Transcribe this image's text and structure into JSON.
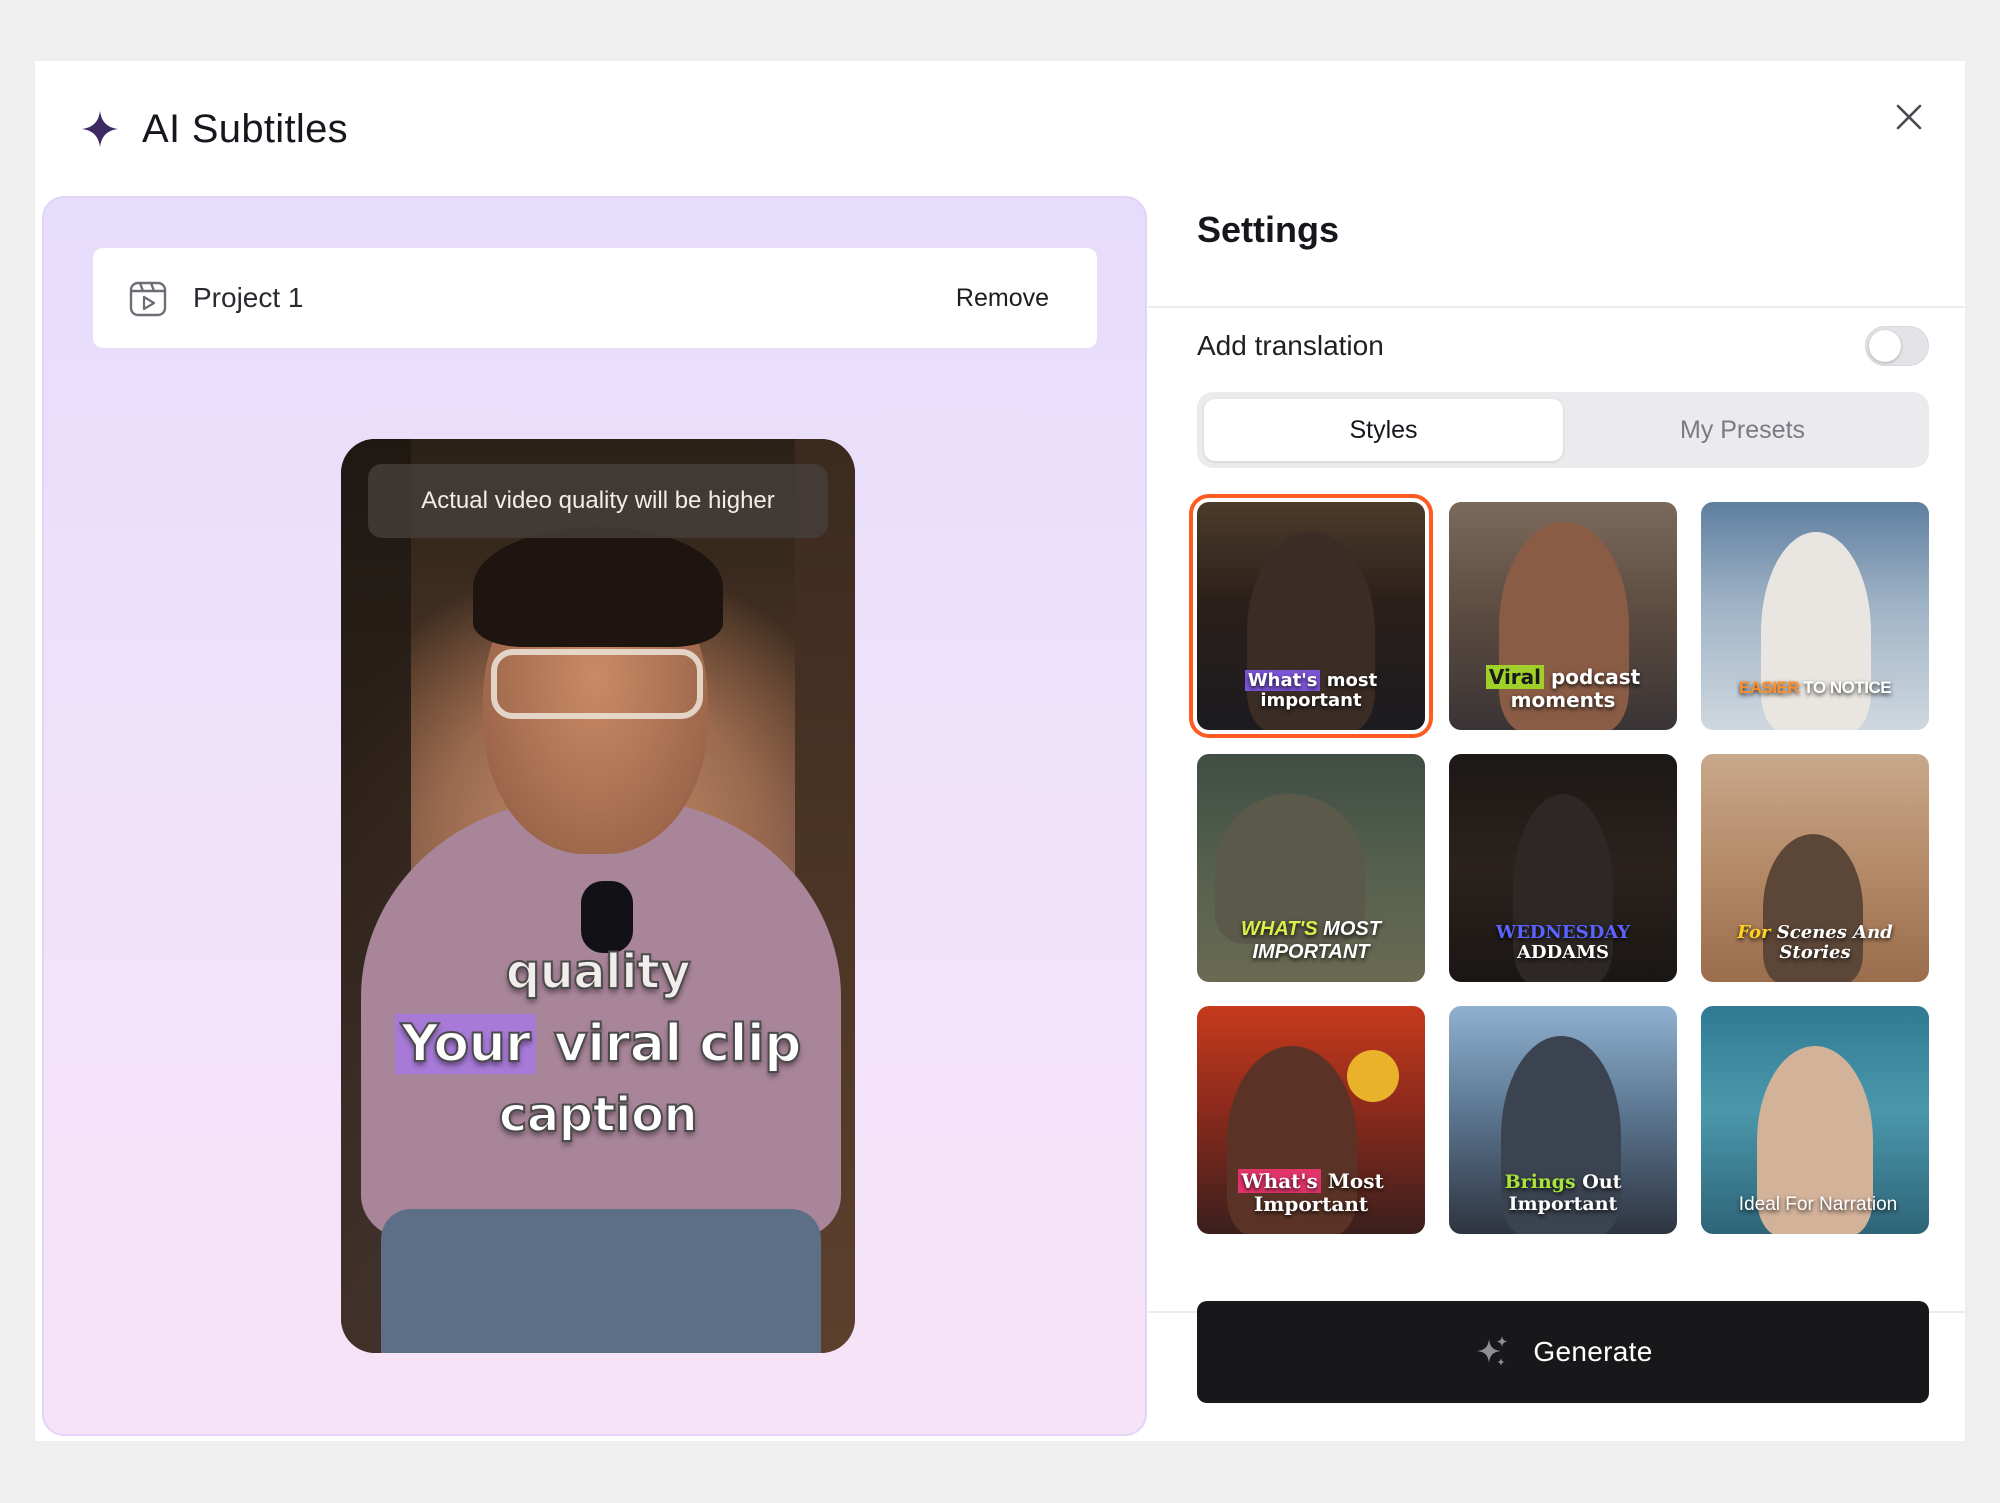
{
  "header": {
    "title": "AI Subtitles",
    "icon": "sparkle-icon",
    "close_icon": "close-icon"
  },
  "preview": {
    "project_name": "Project 1",
    "project_icon": "video-file-icon",
    "remove_label": "Remove",
    "quality_notice": "Actual video quality will be higher",
    "caption_lines": [
      "quality",
      "Your viral clip",
      "caption"
    ],
    "caption_highlight_word": "Your",
    "caption_rest": " viral clip"
  },
  "settings": {
    "title": "Settings",
    "translation_label": "Add translation",
    "translation_enabled": false,
    "tabs": [
      {
        "label": "Styles",
        "active": true
      },
      {
        "label": "My Presets",
        "active": false
      }
    ],
    "styles": [
      {
        "id": "style-1",
        "highlight": "What's",
        "rest": " most important",
        "selected": true
      },
      {
        "id": "style-2",
        "highlight": "Viral",
        "rest": " podcast moments",
        "selected": false
      },
      {
        "id": "style-3",
        "highlight": "EASIER",
        "rest": " TO NOTICE",
        "selected": false
      },
      {
        "id": "style-4",
        "highlight": "WHAT'S",
        "rest": " MOST IMPORTANT",
        "selected": false
      },
      {
        "id": "style-5",
        "highlight": "WEDNESDAY",
        "rest": " ADDAMS",
        "selected": false
      },
      {
        "id": "style-6",
        "highlight": "For",
        "rest": " Scenes And Stories",
        "selected": false
      },
      {
        "id": "style-7",
        "highlight": "What's",
        "rest": " Most Important",
        "selected": false
      },
      {
        "id": "style-8",
        "highlight": "Brings",
        "rest": " Out Important",
        "selected": false
      },
      {
        "id": "style-9",
        "highlight": "",
        "rest": "Ideal For Narration",
        "selected": false
      }
    ],
    "generate_label": "Generate",
    "generate_icon": "sparkles-icon"
  },
  "colors": {
    "accent_selected": "#ff5a1f",
    "primary_button": "#18181b",
    "brand_sparkle": "#3d2a63"
  }
}
